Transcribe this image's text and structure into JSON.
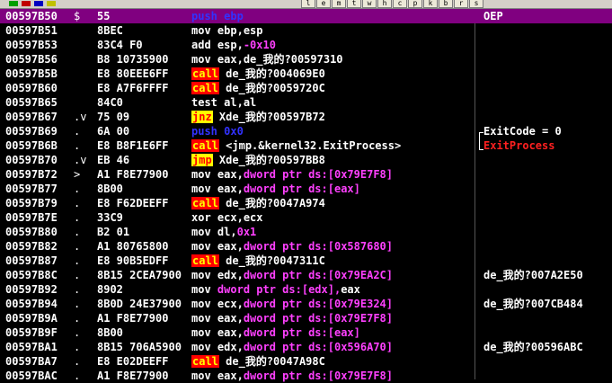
{
  "colors": {
    "background": "#000000",
    "selection": "#800080",
    "call_bg": "#ff0000",
    "call_fg": "#ffff00",
    "jcc_bg": "#ffff00",
    "jcc_fg": "#ff0000",
    "push": "#3232ff",
    "memory": "#ff40ff"
  },
  "toolbar": {
    "icons": [
      "bar-icon",
      "bar-icon",
      "bar-icon",
      "bar-icon",
      "l",
      "e",
      "m",
      "t",
      "w",
      "h",
      "c",
      "p",
      "k",
      "b",
      "r",
      "s"
    ],
    "letters": [
      "l",
      "e",
      "m",
      "t",
      "w",
      "h",
      "c",
      "p",
      "k",
      "b",
      "r",
      "s"
    ]
  },
  "rows": [
    {
      "addr": "00597B50",
      "jmp": "$",
      "hex": "55",
      "mn": "push",
      "mn_type": "push",
      "ops": [
        {
          "t": "ebp",
          "k": "push"
        }
      ],
      "comment": "OEP"
    },
    {
      "addr": "00597B51",
      "jmp": "",
      "hex": "8BEC",
      "mn": "mov",
      "mn_type": "mov",
      "ops": [
        {
          "t": "ebp,esp",
          "k": "reg"
        }
      ],
      "comment": ""
    },
    {
      "addr": "00597B53",
      "jmp": "",
      "hex": "83C4 F0",
      "mn": "add",
      "mn_type": "add",
      "ops": [
        {
          "t": "esp,",
          "k": "reg"
        },
        {
          "t": "-0x10",
          "k": "imm"
        }
      ],
      "comment": ""
    },
    {
      "addr": "00597B56",
      "jmp": "",
      "hex": "B8 10735900",
      "mn": "mov",
      "mn_type": "mov",
      "ops": [
        {
          "t": "eax,de_我的?00597310",
          "k": "reg"
        }
      ],
      "comment": ""
    },
    {
      "addr": "00597B5B",
      "jmp": "",
      "hex": "E8 80EEE6FF",
      "mn": "call",
      "mn_type": "call",
      "ops": [
        {
          "t": "de_我的?004069E0",
          "k": "reg"
        }
      ],
      "comment": ""
    },
    {
      "addr": "00597B60",
      "jmp": "",
      "hex": "E8 A7F6FFFF",
      "mn": "call",
      "mn_type": "call",
      "ops": [
        {
          "t": "de_我的?0059720C",
          "k": "reg"
        }
      ],
      "comment": ""
    },
    {
      "addr": "00597B65",
      "jmp": "",
      "hex": "84C0",
      "mn": "test",
      "mn_type": "test",
      "ops": [
        {
          "t": "al,al",
          "k": "reg"
        }
      ],
      "comment": ""
    },
    {
      "addr": "00597B67",
      "jmp": ".v",
      "hex": "75 09",
      "mn": "jnz",
      "mn_type": "jcc",
      "ops": [
        {
          "t": "Xde_我的?00597B72",
          "k": "reg"
        }
      ],
      "comment": ""
    },
    {
      "addr": "00597B69",
      "jmp": ".",
      "hex": "6A 00",
      "mn": "push",
      "mn_type": "push",
      "ops": [
        {
          "t": "0x0",
          "k": "push"
        }
      ],
      "comment": "ExitCode = 0"
    },
    {
      "addr": "00597B6B",
      "jmp": ".",
      "hex": "E8 B8F1E6FF",
      "mn": "call",
      "mn_type": "call",
      "ops": [
        {
          "t": "<jmp.&kernel32.ExitProcess>",
          "k": "reg"
        }
      ],
      "comment": "ExitProcess",
      "comment_red": true
    },
    {
      "addr": "00597B70",
      "jmp": ".v",
      "hex": "EB 46",
      "mn": "jmp",
      "mn_type": "jcc",
      "ops": [
        {
          "t": "Xde_我的?00597BB8",
          "k": "reg"
        }
      ],
      "comment": ""
    },
    {
      "addr": "00597B72",
      "jmp": ">",
      "hex": "A1 F8E77900",
      "mn": "mov",
      "mn_type": "mov",
      "ops": [
        {
          "t": "eax,",
          "k": "reg"
        },
        {
          "t": "dword ptr ds:[0x79E7F8]",
          "k": "mem"
        }
      ],
      "comment": ""
    },
    {
      "addr": "00597B77",
      "jmp": ".",
      "hex": "8B00",
      "mn": "mov",
      "mn_type": "mov",
      "ops": [
        {
          "t": "eax,",
          "k": "reg"
        },
        {
          "t": "dword ptr ds:[eax]",
          "k": "mem"
        }
      ],
      "comment": ""
    },
    {
      "addr": "00597B79",
      "jmp": ".",
      "hex": "E8 F62DEEFF",
      "mn": "call",
      "mn_type": "call",
      "ops": [
        {
          "t": "de_我的?0047A974",
          "k": "reg"
        }
      ],
      "comment": ""
    },
    {
      "addr": "00597B7E",
      "jmp": ".",
      "hex": "33C9",
      "mn": "xor",
      "mn_type": "mov",
      "ops": [
        {
          "t": "ecx,ecx",
          "k": "reg"
        }
      ],
      "comment": ""
    },
    {
      "addr": "00597B80",
      "jmp": ".",
      "hex": "B2 01",
      "mn": "mov",
      "mn_type": "mov",
      "ops": [
        {
          "t": "dl,",
          "k": "reg"
        },
        {
          "t": "0x1",
          "k": "imm"
        }
      ],
      "comment": ""
    },
    {
      "addr": "00597B82",
      "jmp": ".",
      "hex": "A1 80765800",
      "mn": "mov",
      "mn_type": "mov",
      "ops": [
        {
          "t": "eax,",
          "k": "reg"
        },
        {
          "t": "dword ptr ds:[0x587680]",
          "k": "mem"
        }
      ],
      "comment": ""
    },
    {
      "addr": "00597B87",
      "jmp": ".",
      "hex": "E8 90B5EDFF",
      "mn": "call",
      "mn_type": "call",
      "ops": [
        {
          "t": "de_我的?0047311C",
          "k": "reg"
        }
      ],
      "comment": ""
    },
    {
      "addr": "00597B8C",
      "jmp": ".",
      "hex": "8B15 2CEA7900",
      "mn": "mov",
      "mn_type": "mov",
      "ops": [
        {
          "t": "edx,",
          "k": "reg"
        },
        {
          "t": "dword ptr ds:[0x79EA2C]",
          "k": "mem"
        }
      ],
      "comment": "de_我的?007A2E50"
    },
    {
      "addr": "00597B92",
      "jmp": ".",
      "hex": "8902",
      "mn": "mov",
      "mn_type": "mov",
      "ops": [
        {
          "t": "dword ptr ds:[edx],",
          "k": "mem"
        },
        {
          "t": "eax",
          "k": "reg"
        }
      ],
      "comment": ""
    },
    {
      "addr": "00597B94",
      "jmp": ".",
      "hex": "8B0D 24E37900",
      "mn": "mov",
      "mn_type": "mov",
      "ops": [
        {
          "t": "ecx,",
          "k": "reg"
        },
        {
          "t": "dword ptr ds:[0x79E324]",
          "k": "mem"
        }
      ],
      "comment": "de_我的?007CB484"
    },
    {
      "addr": "00597B9A",
      "jmp": ".",
      "hex": "A1 F8E77900",
      "mn": "mov",
      "mn_type": "mov",
      "ops": [
        {
          "t": "eax,",
          "k": "reg"
        },
        {
          "t": "dword ptr ds:[0x79E7F8]",
          "k": "mem"
        }
      ],
      "comment": ""
    },
    {
      "addr": "00597B9F",
      "jmp": ".",
      "hex": "8B00",
      "mn": "mov",
      "mn_type": "mov",
      "ops": [
        {
          "t": "eax,",
          "k": "reg"
        },
        {
          "t": "dword ptr ds:[eax]",
          "k": "mem"
        }
      ],
      "comment": ""
    },
    {
      "addr": "00597BA1",
      "jmp": ".",
      "hex": "8B15 706A5900",
      "mn": "mov",
      "mn_type": "mov",
      "ops": [
        {
          "t": "edx,",
          "k": "reg"
        },
        {
          "t": "dword ptr ds:[0x596A70]",
          "k": "mem"
        }
      ],
      "comment": "de_我的?00596ABC"
    },
    {
      "addr": "00597BA7",
      "jmp": ".",
      "hex": "E8 E02DEEFF",
      "mn": "call",
      "mn_type": "call",
      "ops": [
        {
          "t": "de_我的?0047A98C",
          "k": "reg"
        }
      ],
      "comment": ""
    },
    {
      "addr": "00597BAC",
      "jmp": ".",
      "hex": "A1 F8E77900",
      "mn": "mov",
      "mn_type": "mov",
      "ops": [
        {
          "t": "eax,",
          "k": "reg"
        },
        {
          "t": "dword ptr ds:[0x79E7F8]",
          "k": "mem"
        }
      ],
      "comment": ""
    }
  ]
}
